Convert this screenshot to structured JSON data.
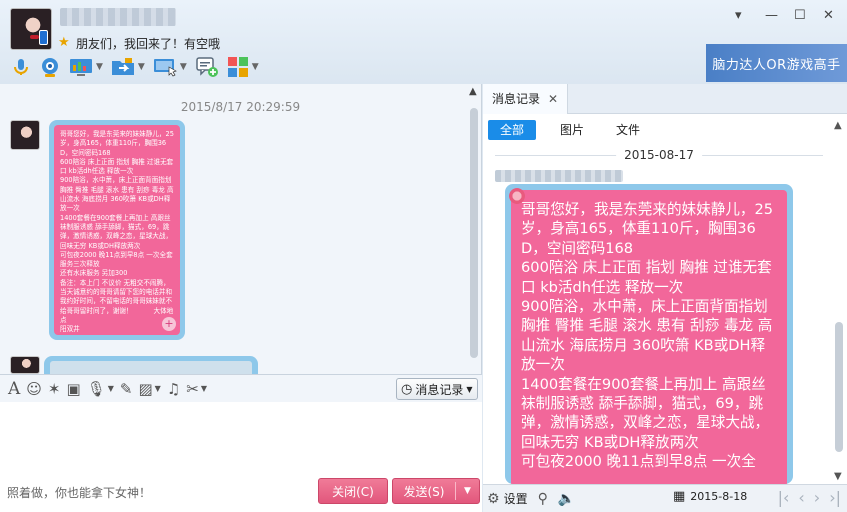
{
  "window": {
    "status_text": "朋友们，我回来了！有空哦",
    "banner_text": "脑力达人OR游戏高手",
    "controls": {
      "menu": "▾",
      "minimize": "—",
      "maximize": "☐",
      "close": "✕"
    }
  },
  "toolbar": {
    "items": [
      {
        "icon": "microphone-icon"
      },
      {
        "icon": "video-call-icon"
      },
      {
        "icon": "screen-share-icon"
      },
      {
        "icon": "file-transfer-icon"
      },
      {
        "icon": "remote-desktop-icon"
      },
      {
        "icon": "add-message-icon"
      },
      {
        "icon": "apps-grid-icon"
      }
    ]
  },
  "chat": {
    "timestamp": "2015/8/17 20:29:59",
    "message1": "哥哥您好，我是东莞来的妹妹静儿，25岁，身高165，体重110斤，胸围36D，空间密码168\n600陪浴 床上正面 指划 胸推 过谁无套口 kb活dh任选 释放一次\n900陪浴，水中萧，床上正面背面指划 胸推 臀推 毛腿 滚水 患有 刮痧 毒龙 高山流水 海底捞月 360吹箫 KB或DH释放一次\n1400套餐在900套餐上再加上 高跟丝袜制服诱惑 舔手舔脚，猫式，69，跳弹，激情诱惑，双峰之恋，星球大战，回味无穷 KB或DH释放两次\n可包夜2000 晚11点到早8点 一次全套服务三次释放\n还有水床服务 另加300\n备注：本上门 不议价 无粗交不闹腾，当天诚意约的哥哥请留下您的电话并和我约好时间，不留电话的哥哥妹妹就不给哥哥留时间了，谢谢！          大体地点\n阳双井"
  },
  "input": {
    "placeholder": "照着做，你也能拿下女神！",
    "history_button": "消息记录",
    "close_button": "关闭(C)",
    "send_button": "发送(S)"
  },
  "history": {
    "title": "消息记录",
    "tabs": [
      "全部",
      "图片",
      "文件"
    ],
    "date_label": "2015-08-17",
    "message": "哥哥您好，我是东莞来的妹妹静儿，25岁，身高165，体重110斤，胸围36D，空间密码168\n600陪浴 床上正面 指划 胸推 过谁无套口 kb活dh任选 释放一次\n900陪浴，水中萧，床上正面背面指划 胸推 臀推 毛腿 滚水 患有 刮痧 毒龙 高山流水 海底捞月 360吹箫 KB或DH释放一次\n1400套餐在900套餐上再加上 高跟丝袜制服诱惑 舔手舔脚，猫式，69，跳弹，激情诱惑，双峰之恋，星球大战，回味无穷 KB或DH释放两次\n可包夜2000 晚11点到早8点 一次全",
    "footer": {
      "settings_label": "设置",
      "date": "2015-8-18"
    }
  },
  "colors": {
    "accent": "#1a8ce8",
    "bubble_pink": "#f2679a",
    "bubble_border": "#8ec8ea",
    "button_pink": "#e2577c"
  }
}
